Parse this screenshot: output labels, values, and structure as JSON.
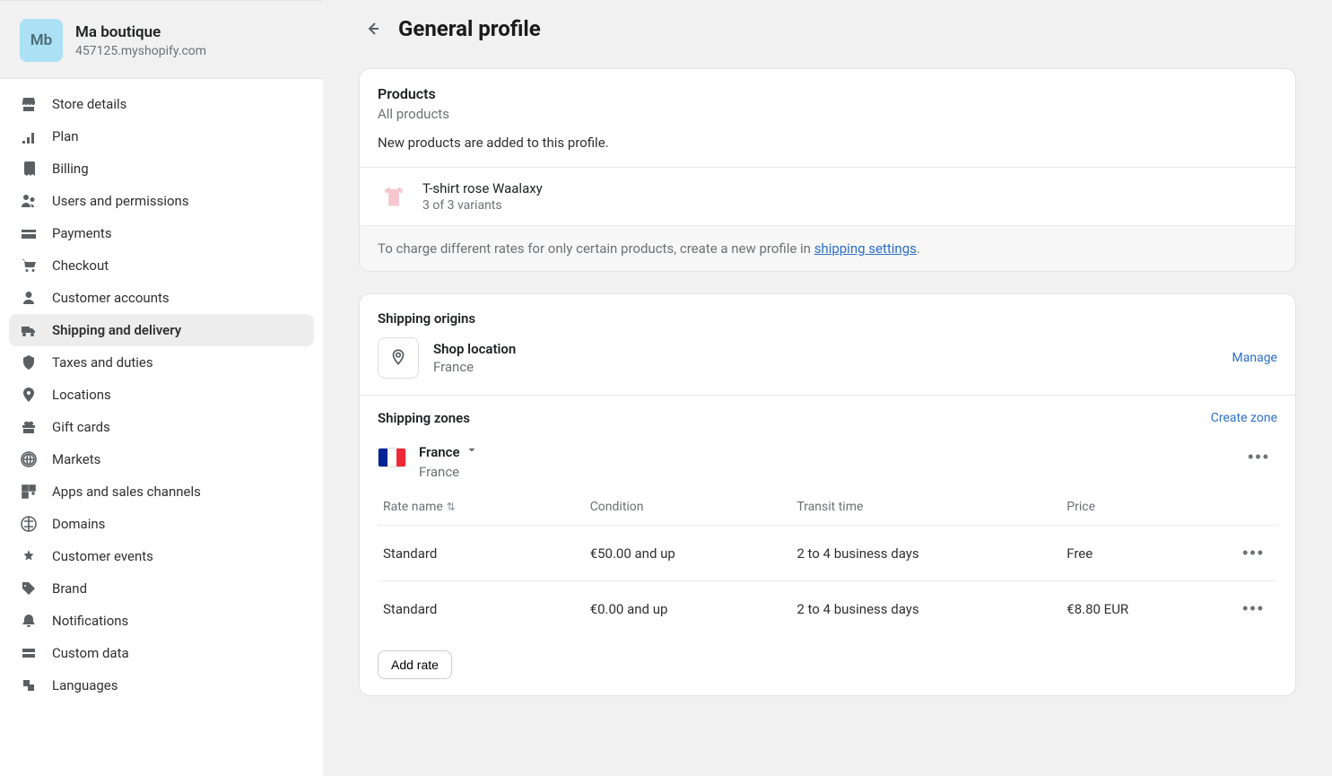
{
  "shop": {
    "badge": "Mb",
    "name": "Ma boutique",
    "domain": "457125.myshopify.com"
  },
  "nav": [
    {
      "key": "store-details",
      "label": "Store details"
    },
    {
      "key": "plan",
      "label": "Plan"
    },
    {
      "key": "billing",
      "label": "Billing"
    },
    {
      "key": "users",
      "label": "Users and permissions"
    },
    {
      "key": "payments",
      "label": "Payments"
    },
    {
      "key": "checkout",
      "label": "Checkout"
    },
    {
      "key": "customer-accounts",
      "label": "Customer accounts"
    },
    {
      "key": "shipping",
      "label": "Shipping and delivery"
    },
    {
      "key": "taxes",
      "label": "Taxes and duties"
    },
    {
      "key": "locations",
      "label": "Locations"
    },
    {
      "key": "gift-cards",
      "label": "Gift cards"
    },
    {
      "key": "markets",
      "label": "Markets"
    },
    {
      "key": "apps",
      "label": "Apps and sales channels"
    },
    {
      "key": "domains",
      "label": "Domains"
    },
    {
      "key": "customer-events",
      "label": "Customer events"
    },
    {
      "key": "brand",
      "label": "Brand"
    },
    {
      "key": "notifications",
      "label": "Notifications"
    },
    {
      "key": "custom-data",
      "label": "Custom data"
    },
    {
      "key": "languages",
      "label": "Languages"
    }
  ],
  "page": {
    "title": "General profile"
  },
  "products": {
    "title": "Products",
    "subtitle": "All products",
    "description": "New products are added to this profile.",
    "item": {
      "name": "T-shirt rose Waalaxy",
      "variants": "3 of 3 variants"
    },
    "footer_prefix": "To charge different rates for only certain products, create a new profile in ",
    "footer_link": "shipping settings",
    "footer_suffix": "."
  },
  "origins": {
    "title": "Shipping origins",
    "location": {
      "name": "Shop location",
      "sub": "France"
    },
    "manage": "Manage"
  },
  "zones": {
    "title": "Shipping zones",
    "create": "Create zone",
    "zone": {
      "name": "France",
      "sub": "France"
    },
    "table": {
      "headers": {
        "rate": "Rate name",
        "condition": "Condition",
        "transit": "Transit time",
        "price": "Price"
      },
      "rows": [
        {
          "name": "Standard",
          "condition": "€50.00 and up",
          "transit": "2 to 4 business days",
          "price": "Free"
        },
        {
          "name": "Standard",
          "condition": "€0.00 and up",
          "transit": "2 to 4 business days",
          "price": "€8.80 EUR"
        }
      ]
    },
    "add_rate": "Add rate"
  }
}
